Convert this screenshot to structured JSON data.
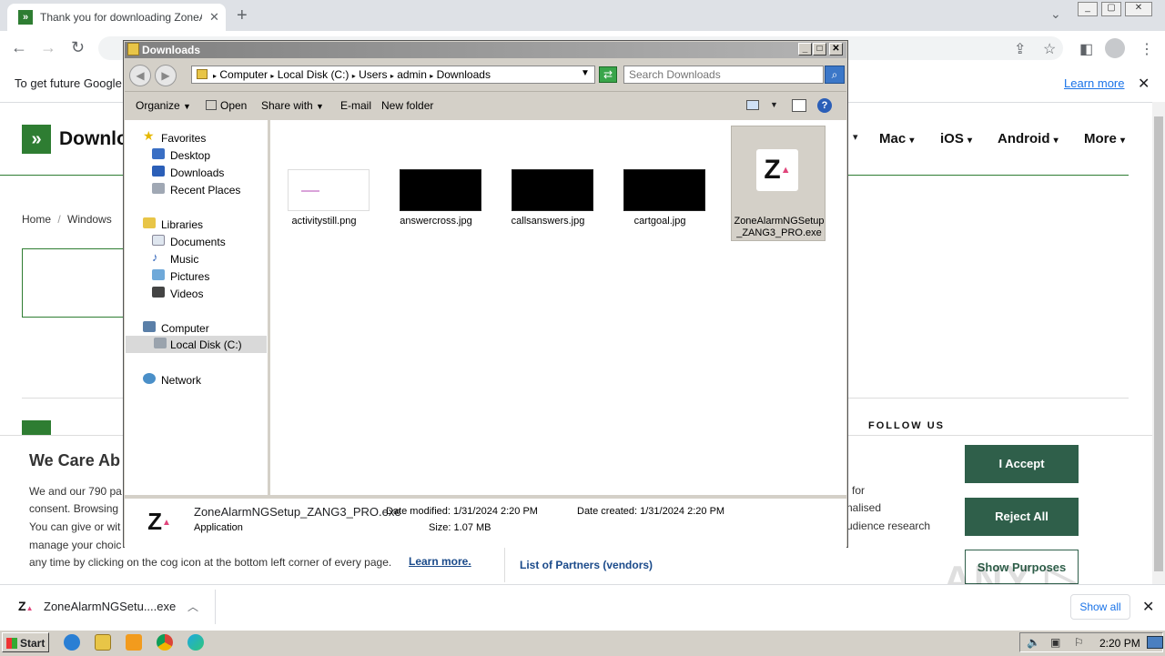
{
  "chrome": {
    "tab_title": "Thank you for downloading ZoneAlarm",
    "tab_close": "✕",
    "new_tab": "+",
    "infobar_text": "To get future Google",
    "infobar_learn_more": "Learn more",
    "infobar_close": "✕"
  },
  "site": {
    "logo_glyph": "»",
    "name": "Downlo",
    "nav": [
      "Mac",
      "iOS",
      "Android",
      "More"
    ],
    "breadcrumb": [
      "Home",
      "Windows"
    ],
    "follow_us": "FOLLOW US"
  },
  "cookie": {
    "title": "We Care Ab",
    "line1": "We and our 790 pa",
    "line2": "consent. Browsing",
    "line3": "You can give or wit",
    "line4": "manage your choic",
    "line5": "any time by clicking on the cog icon at the bottom left corner of every page.",
    "learn_more": "Learn more.",
    "right1": "for",
    "right2": "nalised",
    "right3": "udience research",
    "partners": "List of Partners (vendors)",
    "accept": "I Accept",
    "reject": "Reject All",
    "purposes": "Show Purposes"
  },
  "download_shelf": {
    "file": "ZoneAlarmNGSetu....exe",
    "show_all": "Show all"
  },
  "explorer": {
    "title": "Downloads",
    "address": [
      "Computer",
      "Local Disk (C:)",
      "Users",
      "admin",
      "Downloads"
    ],
    "search_placeholder": "Search Downloads",
    "commands": {
      "organize": "Organize",
      "open": "Open",
      "share_with": "Share with",
      "email": "E-mail",
      "new_folder": "New folder"
    },
    "nav": {
      "favorites": "Favorites",
      "desktop": "Desktop",
      "downloads": "Downloads",
      "recent": "Recent Places",
      "libraries": "Libraries",
      "documents": "Documents",
      "music": "Music",
      "pictures": "Pictures",
      "videos": "Videos",
      "computer": "Computer",
      "local_disk": "Local Disk (C:)",
      "network": "Network"
    },
    "files": [
      {
        "name": "activitystill.png"
      },
      {
        "name": "answercross.jpg"
      },
      {
        "name": "callsanswers.jpg"
      },
      {
        "name": "cartgoal.jpg"
      },
      {
        "name": "ZoneAlarmNGSetup_ZANG3_PRO.exe",
        "line1": "ZoneAlarmNGSetup",
        "line2": "_ZANG3_PRO.exe"
      }
    ],
    "details": {
      "name": "ZoneAlarmNGSetup_ZANG3_PRO.exe",
      "type": "Application",
      "modified_label": "Date modified:",
      "modified": "1/31/2024 2:20 PM",
      "created_label": "Date created:",
      "created": "1/31/2024 2:20 PM",
      "size_label": "Size:",
      "size": "1.07 MB"
    }
  },
  "taskbar": {
    "start": "Start",
    "clock": "2:20 PM"
  },
  "watermark": "ANY RUN",
  "colors": {
    "site_green": "#2e7d32",
    "cookie_button": "#2f5f4a",
    "link_blue": "#1a73e8"
  }
}
